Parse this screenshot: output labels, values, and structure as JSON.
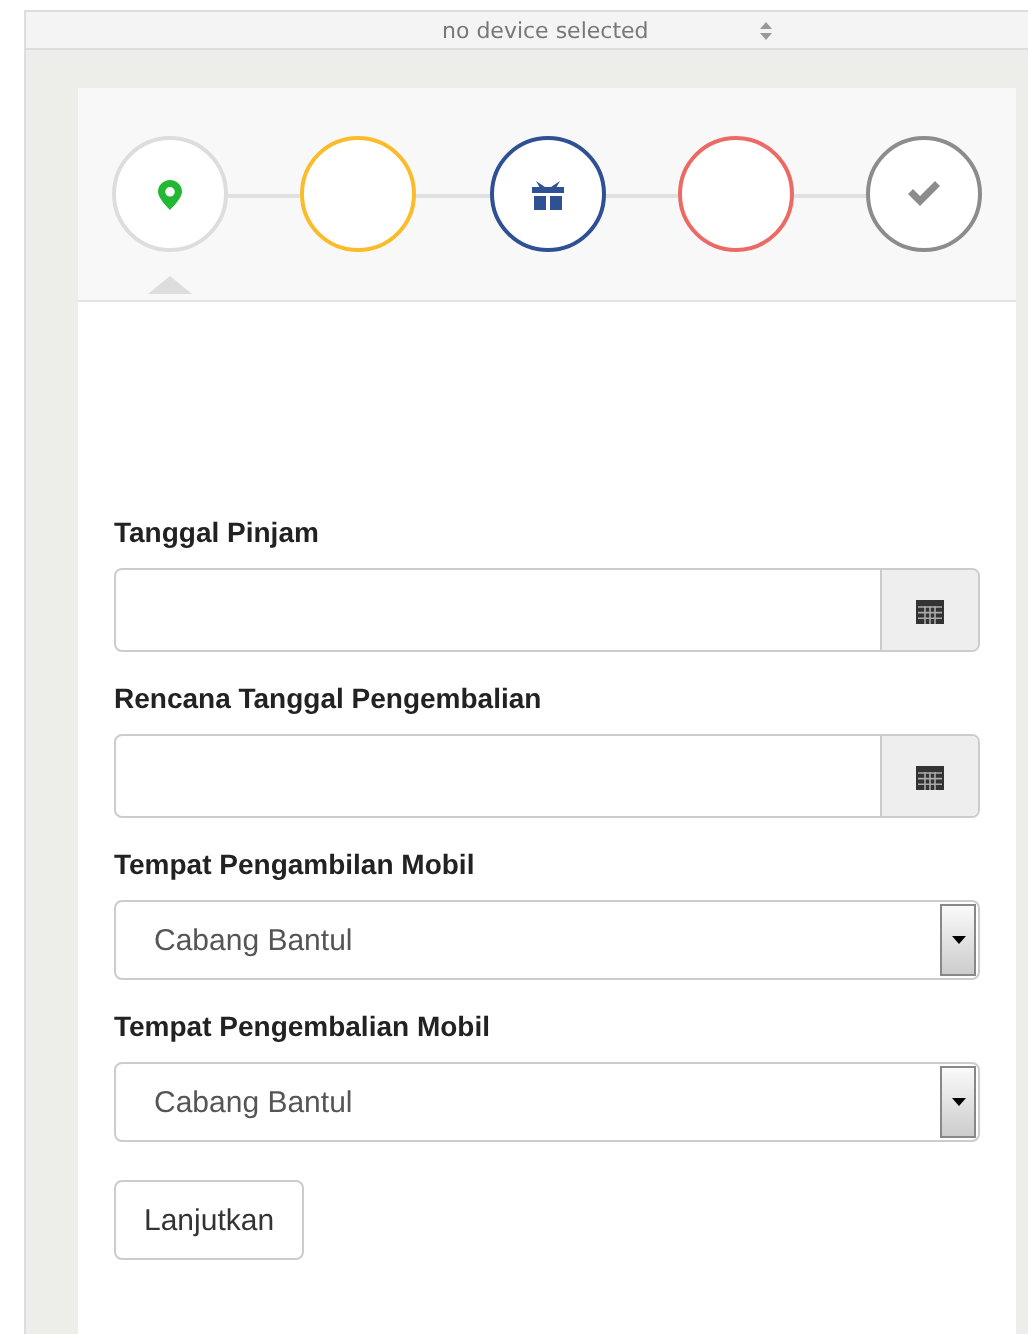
{
  "device_bar": {
    "label": "no device selected"
  },
  "steps": [
    {
      "kind": "pin",
      "color": "#dddddd",
      "selected": true
    },
    {
      "kind": "empty",
      "color": "#fbbc2c",
      "selected": false
    },
    {
      "kind": "gift",
      "color": "#2f5193",
      "selected": false
    },
    {
      "kind": "empty",
      "color": "#ec6a64",
      "selected": false
    },
    {
      "kind": "check",
      "color": "#8c8c8c",
      "selected": false
    }
  ],
  "fields": [
    {
      "kind": "date",
      "label": "Tanggal Pinjam"
    },
    {
      "kind": "date",
      "label": "Rencana Tanggal Pengembalian"
    },
    {
      "kind": "select",
      "label": "Tempat Pengambilan Mobil",
      "value": "Cabang Bantul"
    },
    {
      "kind": "select",
      "label": "Tempat Pengembalian Mobil",
      "value": "Cabang Bantul"
    }
  ],
  "submit": "Lanjutkan"
}
